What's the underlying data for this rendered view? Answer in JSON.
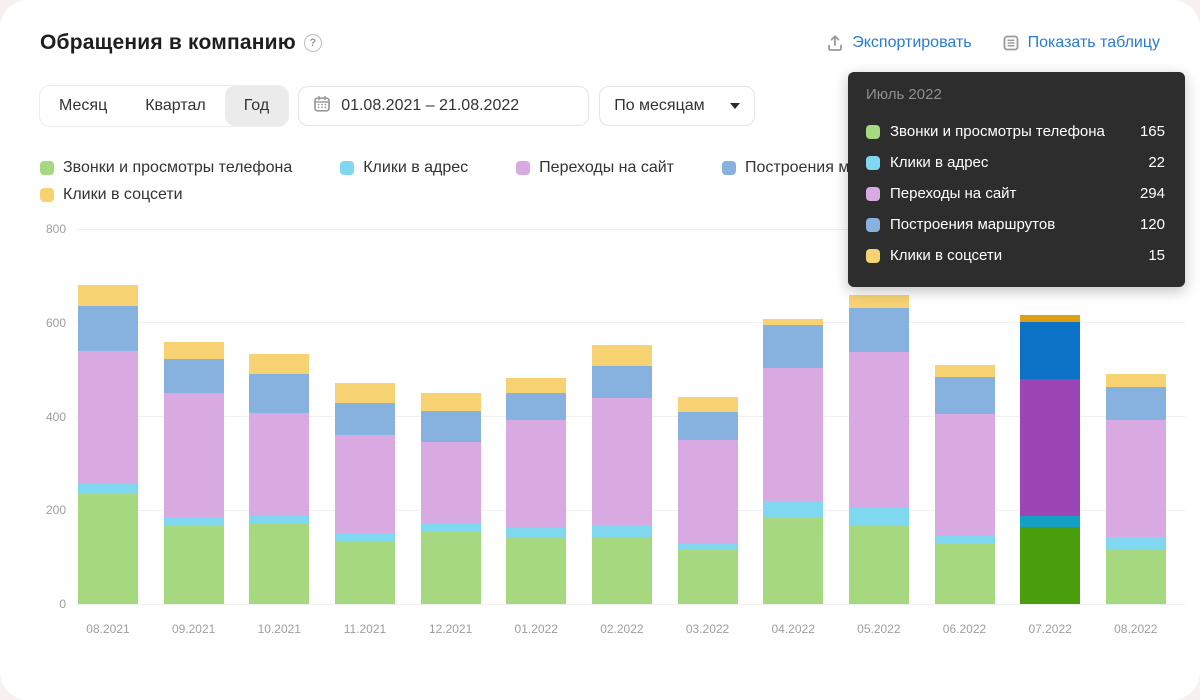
{
  "header": {
    "title": "Обращения в компанию",
    "help_icon": "?",
    "export_label": "Экспортировать",
    "show_table_label": "Показать таблицу",
    "link_color": "#2b7bd3",
    "icon_color": "#9a9a9a"
  },
  "controls": {
    "period_tabs": [
      {
        "label": "Месяц",
        "selected": false
      },
      {
        "label": "Квартал",
        "selected": false
      },
      {
        "label": "Год",
        "selected": true
      }
    ],
    "date_range": "01.08.2021 – 21.08.2022",
    "group_by": "По месяцам"
  },
  "legend": {
    "items": [
      {
        "label": "Звонки и просмотры телефона",
        "color": "#a5d87f"
      },
      {
        "label": "Клики в адрес",
        "color": "#7fd8f0"
      },
      {
        "label": "Переходы на сайт",
        "color": "#d9a9e2"
      },
      {
        "label": "Построения маршрутов",
        "color": "#87b2e0"
      },
      {
        "label": "Клики в соцсети",
        "color": "#f6d273"
      }
    ]
  },
  "tooltip": {
    "title": "Июль 2022",
    "bg": "#2d2d2d",
    "rows": [
      {
        "label": "Звонки и просмотры телефона",
        "value": "165",
        "color": "#a5d87f"
      },
      {
        "label": "Клики в адрес",
        "value": "22",
        "color": "#7fd8f0"
      },
      {
        "label": "Переходы на сайт",
        "value": "294",
        "color": "#d9a9e2"
      },
      {
        "label": "Построения маршрутов",
        "value": "120",
        "color": "#87b2e0"
      },
      {
        "label": "Клики в соцсети",
        "value": "15",
        "color": "#f6d273"
      }
    ]
  },
  "chart_data": {
    "type": "bar",
    "stacked": true,
    "title": "Обращения в компанию",
    "xlabel": "",
    "ylabel": "",
    "ylim": [
      0,
      800
    ],
    "yticks": [
      0,
      200,
      400,
      600,
      800
    ],
    "grid": true,
    "legend_position": "top",
    "highlighted_index": 11,
    "highlighted_category": "07.2022",
    "categories": [
      "08.2021",
      "09.2021",
      "10.2021",
      "11.2021",
      "12.2021",
      "01.2022",
      "02.2022",
      "03.2022",
      "04.2022",
      "05.2022",
      "06.2022",
      "07.2022",
      "08.2022"
    ],
    "series": [
      {
        "name": "Звонки и просмотры телефона",
        "color": "#a5d87f",
        "highlight_color": "#4a9e0b",
        "values": [
          235,
          167,
          172,
          135,
          153,
          144,
          140,
          115,
          184,
          168,
          129,
          165,
          117
        ]
      },
      {
        "name": "Клики в адрес",
        "color": "#7fd8f0",
        "highlight_color": "#14a0c2",
        "values": [
          21,
          19,
          16,
          16,
          19,
          21,
          28,
          14,
          36,
          36,
          19,
          22,
          25
        ]
      },
      {
        "name": "Переходы на сайт",
        "color": "#d9a9e2",
        "highlight_color": "#9c45b4",
        "values": [
          284,
          264,
          219,
          210,
          174,
          228,
          272,
          221,
          283,
          334,
          258,
          294,
          251
        ]
      },
      {
        "name": "Построения маршрутов",
        "color": "#87b2e0",
        "highlight_color": "#0c72c6",
        "values": [
          96,
          73,
          84,
          67,
          65,
          57,
          68,
          59,
          92,
          93,
          78,
          120,
          71
        ]
      },
      {
        "name": "Клики в соцсети",
        "color": "#f6d273",
        "highlight_color": "#e0a013",
        "values": [
          44,
          37,
          42,
          44,
          39,
          33,
          45,
          32,
          14,
          28,
          26,
          15,
          26
        ]
      }
    ]
  }
}
